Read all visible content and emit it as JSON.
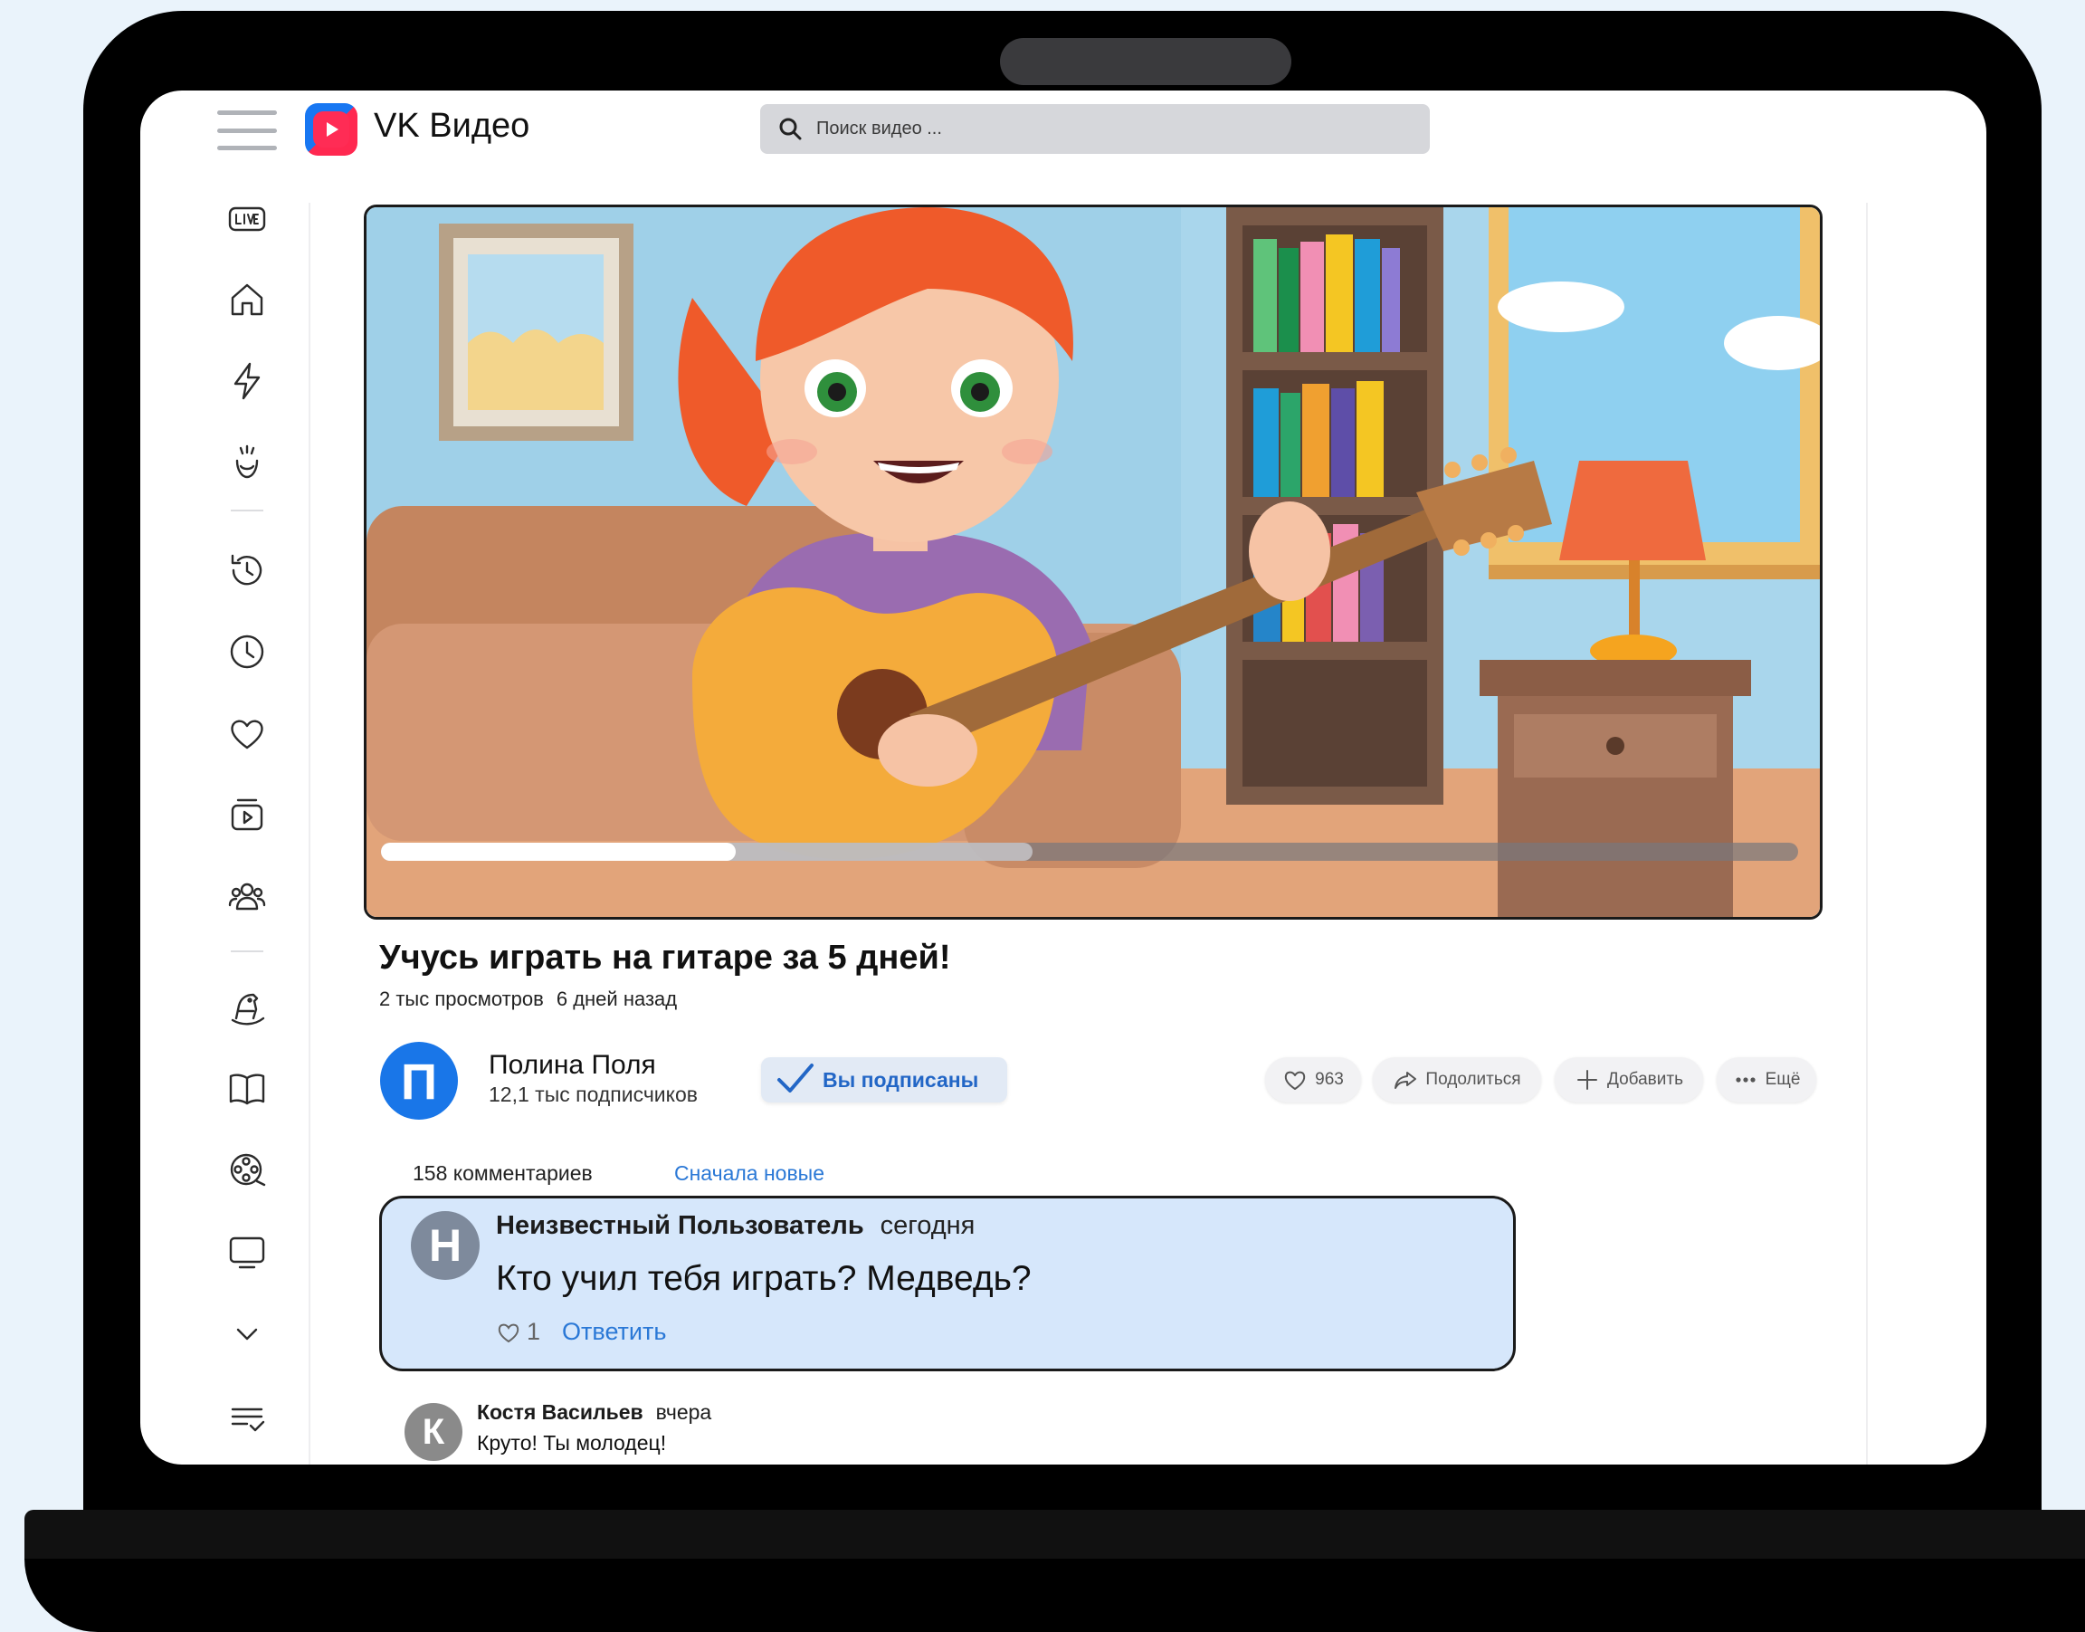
{
  "app": {
    "logo_text": "VK Видео",
    "search_placeholder": "Поиск видео ..."
  },
  "sidebar": {
    "items": [
      {
        "name": "live",
        "icon": "live-icon"
      },
      {
        "name": "home",
        "icon": "home-icon"
      },
      {
        "name": "shorts",
        "icon": "lightning-icon"
      },
      {
        "name": "kids",
        "icon": "hand-icon"
      },
      {
        "name": "history",
        "icon": "history-icon"
      },
      {
        "name": "watch-later",
        "icon": "clock-icon"
      },
      {
        "name": "liked",
        "icon": "heart-icon"
      },
      {
        "name": "my-videos",
        "icon": "playlist-icon"
      },
      {
        "name": "subscriptions",
        "icon": "people-icon"
      },
      {
        "name": "kids-zone",
        "icon": "rocking-horse-icon"
      },
      {
        "name": "education",
        "icon": "book-icon"
      },
      {
        "name": "movies",
        "icon": "film-reel-icon"
      },
      {
        "name": "tv",
        "icon": "tv-icon"
      },
      {
        "name": "more",
        "icon": "chevron-down-icon"
      },
      {
        "name": "lists",
        "icon": "list-check-icon"
      }
    ]
  },
  "player": {
    "progress_played": 0.25,
    "progress_buffered": 0.46
  },
  "video": {
    "title": "Учусь играть на гитаре за 5 дней!",
    "views": "2 тыс просмотров",
    "age": "6 дней назад"
  },
  "channel": {
    "avatar_letter": "П",
    "name": "Полина Поля",
    "subscribers": "12,1 тыс подписчиков",
    "subscribed_label": "Вы подписаны"
  },
  "actions": {
    "likes": "963",
    "share": "Подолиться",
    "add": "Добавить",
    "more": "Ещё"
  },
  "comments": {
    "count_label": "158 комментариев",
    "sort_label": "Сначала новые",
    "items": [
      {
        "avatar_letter": "Н",
        "author": "Неизвестный Пользователь",
        "time": "сегодня",
        "text": "Кто учил тебя играть? Медведь?",
        "likes": "1",
        "reply_label": "Ответить"
      },
      {
        "avatar_letter": "К",
        "author": "Костя Васильев",
        "time": "вчера",
        "text": "Круто! Ты молодец!"
      }
    ]
  },
  "colors": {
    "accent_blue": "#2a78d6",
    "highlight_bg": "#d6e7fb",
    "logo_red": "#ff2c55"
  }
}
